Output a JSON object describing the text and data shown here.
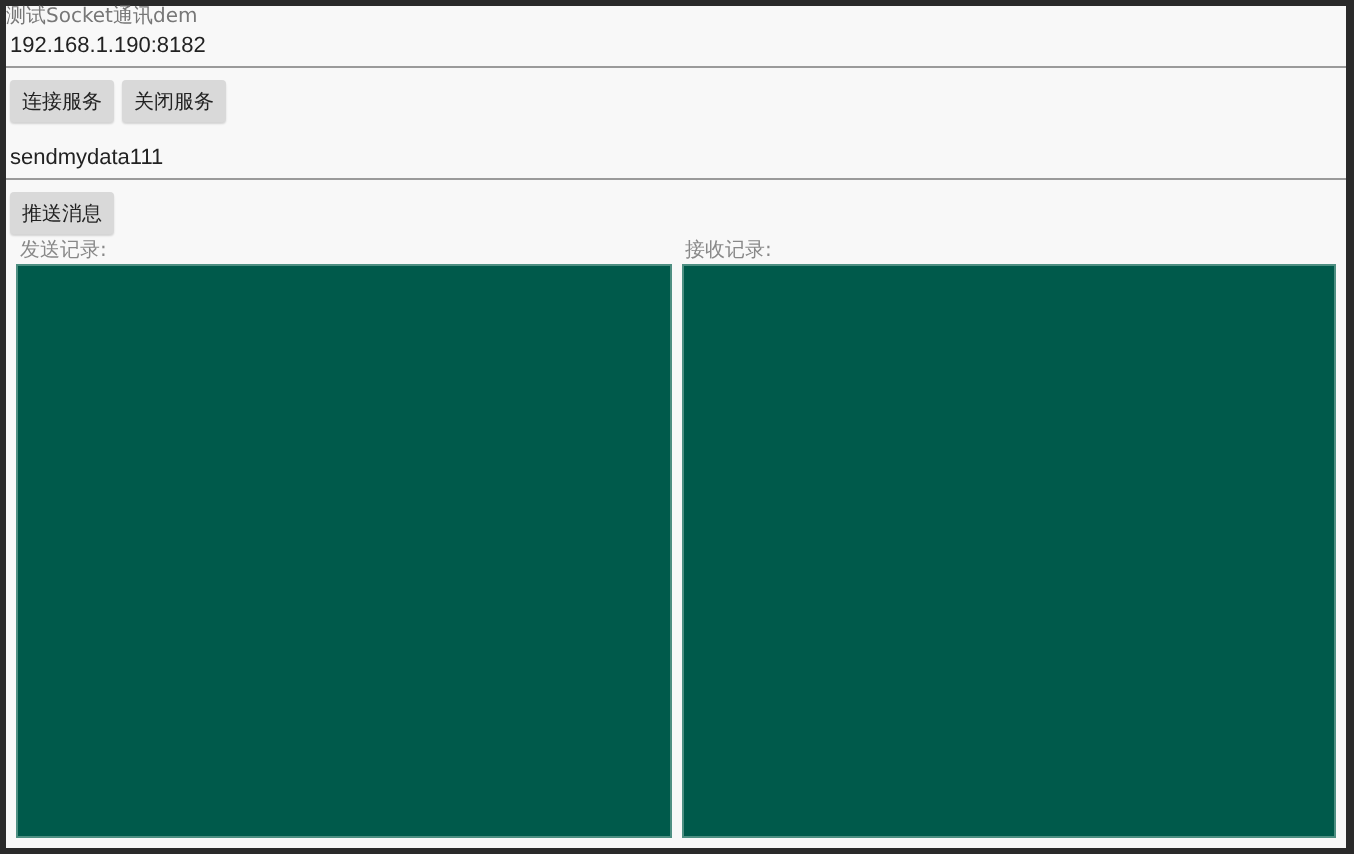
{
  "window": {
    "title": "测试Socket通讯dem"
  },
  "address_field": {
    "value": "192.168.1.190:8182"
  },
  "connection_buttons": [
    "连接服务",
    "关闭服务"
  ],
  "message_field": {
    "value": "sendmydata111"
  },
  "send_button": "推送消息",
  "logs": [
    {
      "label": "发送记录:"
    },
    {
      "label": "接收记录:"
    }
  ]
}
